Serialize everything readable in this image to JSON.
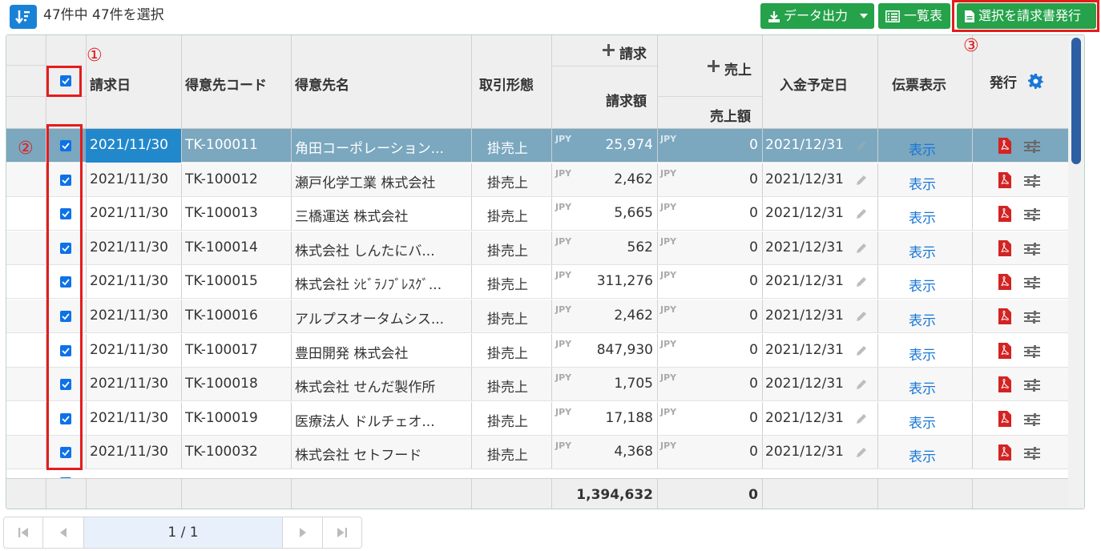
{
  "toolbar": {
    "count_text": "47件中 47件を選択",
    "export_label": "データ出力",
    "list_label": "一覧表",
    "issue_label": "選択を請求書発行"
  },
  "annotations": {
    "one": "①",
    "two": "②",
    "three": "③"
  },
  "header": {
    "date": "請求日",
    "code": "得意先コード",
    "name": "得意先名",
    "type": "取引形態",
    "billing_group": "請求",
    "billing_amount": "請求額",
    "sales_group": "売上",
    "sales_amount": "売上額",
    "due": "入金予定日",
    "slip": "伝票表示",
    "issue": "発行"
  },
  "rows": [
    {
      "date": "2021/11/30",
      "code": "TK-100011",
      "name": "角田コーポレーション...",
      "type": "掛売上",
      "currency": "JPY",
      "billing": "25,974",
      "sales_currency": "JPY",
      "sales": "0",
      "due": "2021/12/31",
      "slip": "表示"
    },
    {
      "date": "2021/11/30",
      "code": "TK-100012",
      "name": "瀬戸化学工業 株式会社",
      "type": "掛売上",
      "currency": "JPY",
      "billing": "2,462",
      "sales_currency": "JPY",
      "sales": "0",
      "due": "2021/12/31",
      "slip": "表示"
    },
    {
      "date": "2021/11/30",
      "code": "TK-100013",
      "name": "三橋運送 株式会社",
      "type": "掛売上",
      "currency": "JPY",
      "billing": "5,665",
      "sales_currency": "JPY",
      "sales": "0",
      "due": "2021/12/31",
      "slip": "表示"
    },
    {
      "date": "2021/11/30",
      "code": "TK-100014",
      "name": "株式会社 しんたにバ...",
      "type": "掛売上",
      "currency": "JPY",
      "billing": "562",
      "sales_currency": "JPY",
      "sales": "0",
      "due": "2021/12/31",
      "slip": "表示"
    },
    {
      "date": "2021/11/30",
      "code": "TK-100015",
      "name": "株式会社 ｼﾋﾞﾗﾉﾌﾞﾚｽｸﾞ...",
      "type": "掛売上",
      "currency": "JPY",
      "billing": "311,276",
      "sales_currency": "JPY",
      "sales": "0",
      "due": "2021/12/31",
      "slip": "表示"
    },
    {
      "date": "2021/11/30",
      "code": "TK-100016",
      "name": "アルプスオータムシス...",
      "type": "掛売上",
      "currency": "JPY",
      "billing": "2,462",
      "sales_currency": "JPY",
      "sales": "0",
      "due": "2021/12/31",
      "slip": "表示"
    },
    {
      "date": "2021/11/30",
      "code": "TK-100017",
      "name": "豊田開発 株式会社",
      "type": "掛売上",
      "currency": "JPY",
      "billing": "847,930",
      "sales_currency": "JPY",
      "sales": "0",
      "due": "2021/12/31",
      "slip": "表示"
    },
    {
      "date": "2021/11/30",
      "code": "TK-100018",
      "name": "株式会社 せんだ製作所",
      "type": "掛売上",
      "currency": "JPY",
      "billing": "1,705",
      "sales_currency": "JPY",
      "sales": "0",
      "due": "2021/12/31",
      "slip": "表示"
    },
    {
      "date": "2021/11/30",
      "code": "TK-100019",
      "name": "医療法人 ドルチェオ...",
      "type": "掛売上",
      "currency": "JPY",
      "billing": "17,188",
      "sales_currency": "JPY",
      "sales": "0",
      "due": "2021/12/31",
      "slip": "表示"
    },
    {
      "date": "2021/11/30",
      "code": "TK-100032",
      "name": "株式会社 セトフード",
      "type": "掛売上",
      "currency": "JPY",
      "billing": "4,368",
      "sales_currency": "JPY",
      "sales": "0",
      "due": "2021/12/31",
      "slip": "表示"
    }
  ],
  "footer": {
    "billing_total": "1,394,632",
    "sales_total": "0"
  },
  "pager": {
    "page_text": "1 / 1"
  },
  "colors": {
    "accent_green": "#25a24a",
    "selected_row": "#7ba7bf",
    "highlight_red": "#e41c1c"
  },
  "icons": [
    "sort-icon",
    "download-icon",
    "caret-down-icon",
    "list-icon",
    "document-icon",
    "gear-icon",
    "pdf-icon",
    "sliders-icon",
    "pencil-icon",
    "first-page-icon",
    "prev-page-icon",
    "next-page-icon",
    "last-page-icon"
  ]
}
